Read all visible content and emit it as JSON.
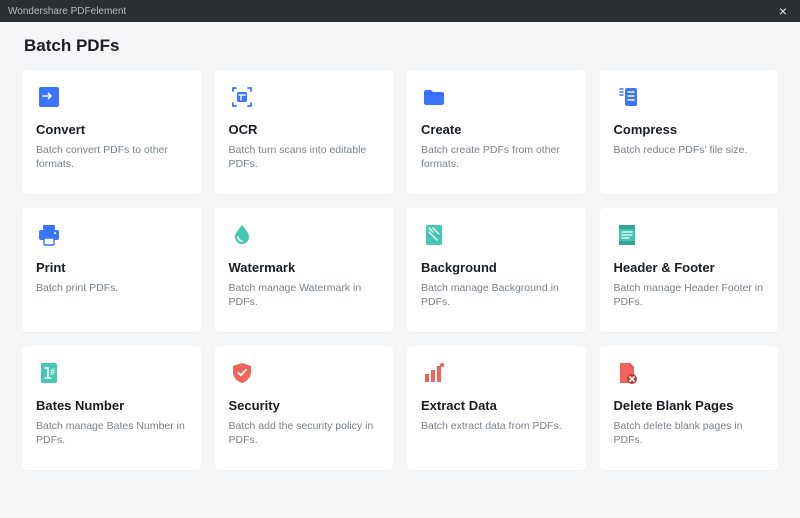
{
  "window": {
    "title": "Wondershare PDFelement"
  },
  "page": {
    "heading": "Batch PDFs"
  },
  "cards": [
    {
      "id": "convert",
      "title": "Convert",
      "desc": "Batch convert PDFs to other formats."
    },
    {
      "id": "ocr",
      "title": "OCR",
      "desc": "Batch turn scans into editable PDFs."
    },
    {
      "id": "create",
      "title": "Create",
      "desc": "Batch create PDFs from other formats."
    },
    {
      "id": "compress",
      "title": "Compress",
      "desc": "Batch reduce PDFs' file size."
    },
    {
      "id": "print",
      "title": "Print",
      "desc": "Batch print PDFs."
    },
    {
      "id": "watermark",
      "title": "Watermark",
      "desc": "Batch manage Watermark in PDFs."
    },
    {
      "id": "background",
      "title": "Background",
      "desc": "Batch manage Background in PDFs."
    },
    {
      "id": "header-footer",
      "title": "Header & Footer",
      "desc": "Batch manage Header  Footer in PDFs."
    },
    {
      "id": "bates-number",
      "title": "Bates Number",
      "desc": "Batch manage Bates Number in PDFs."
    },
    {
      "id": "security",
      "title": "Security",
      "desc": "Batch add the security policy in PDFs."
    },
    {
      "id": "extract-data",
      "title": "Extract Data",
      "desc": "Batch extract data from PDFs."
    },
    {
      "id": "delete-blank",
      "title": "Delete Blank Pages",
      "desc": "Batch delete blank pages in PDFs."
    }
  ],
  "colors": {
    "blue": "#3a74ff",
    "teal": "#45c7b1",
    "red": "#f0645d"
  }
}
